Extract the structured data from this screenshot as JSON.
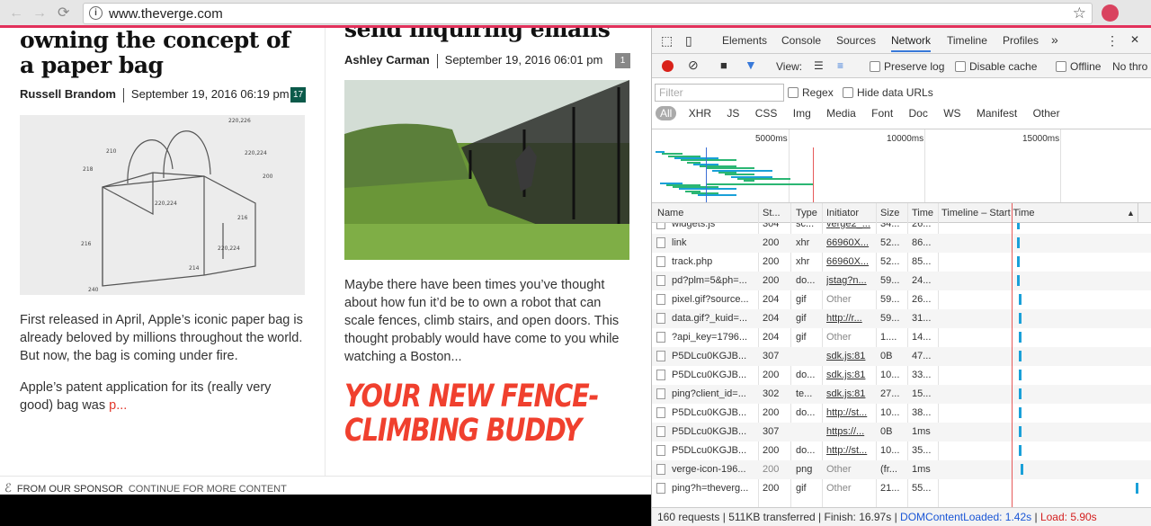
{
  "browser": {
    "url": "www.theverge.com",
    "info_icon": "i",
    "back_icon": "←",
    "forward_icon": "→",
    "reload_icon": "⟳",
    "star_icon": "☆"
  },
  "articles": [
    {
      "headline": "owning the concept of a paper bag",
      "author": "Russell Brandom",
      "date": "September 19, 2016 06:19 pm",
      "comments": "17",
      "excerpt_1": "First released in April, Apple’s iconic paper bag is already beloved by millions throughout the world. But now, the bag is coming under fire.",
      "excerpt_2": "Apple’s patent application for its (really very good) bag was ",
      "excerpt_2_link": "p..."
    },
    {
      "headline": "send inquiring emails",
      "author": "Ashley Carman",
      "date": "September 19, 2016 06:01 pm",
      "comments": "1",
      "excerpt_1": "Maybe there have been times you’ve thought about how fun it’d be to own a robot that can scale fences, climb stairs, and open doors. This thought probably would have come to you while watching a Boston...",
      "promo": "YOUR NEW FENCE-CLIMBING BUDDY"
    }
  ],
  "sponsor": {
    "label": "FROM OUR SPONSOR",
    "continue": "CONTINUE FOR MORE CONTENT"
  },
  "devtools": {
    "tabs": [
      "Elements",
      "Console",
      "Sources",
      "Network",
      "Timeline",
      "Profiles"
    ],
    "more": "»",
    "menu": "⋮",
    "close": "✕",
    "active_tab": "Network",
    "toolbar": {
      "view_label": "View:",
      "preserve_log": "Preserve log",
      "disable_cache": "Disable cache",
      "offline": "Offline",
      "throttle": "No thro"
    },
    "filter": {
      "placeholder": "Filter",
      "regex": "Regex",
      "hide_data_urls": "Hide data URLs",
      "types": [
        "All",
        "XHR",
        "JS",
        "CSS",
        "Img",
        "Media",
        "Font",
        "Doc",
        "WS",
        "Manifest",
        "Other"
      ]
    },
    "overview_ticks": [
      "5000ms",
      "10000ms",
      "15000ms"
    ],
    "columns": [
      "Name",
      "St...",
      "Type",
      "Initiator",
      "Size",
      "Time",
      "Timeline – Start Time"
    ],
    "sort_icon": "▲",
    "rows": [
      {
        "name": "widgets.js",
        "status": "304",
        "type": "sc...",
        "initiator": "verge2_...",
        "size": "34...",
        "time": "26...",
        "link": true,
        "start": 0.38
      },
      {
        "name": "link",
        "status": "200",
        "type": "xhr",
        "initiator": "66960X...",
        "size": "52...",
        "time": "86...",
        "link": true,
        "start": 0.38
      },
      {
        "name": "track.php",
        "status": "200",
        "type": "xhr",
        "initiator": "66960X...",
        "size": "52...",
        "time": "85...",
        "link": true,
        "start": 0.38
      },
      {
        "name": "pd?plm=5&ph=...",
        "status": "200",
        "type": "do...",
        "initiator": "jstag?n...",
        "size": "59...",
        "time": "24...",
        "link": true,
        "start": 0.38
      },
      {
        "name": "pixel.gif?source...",
        "status": "204",
        "type": "gif",
        "initiator": "Other",
        "size": "59...",
        "time": "26...",
        "link": false,
        "start": 0.39
      },
      {
        "name": "data.gif?_kuid=...",
        "status": "204",
        "type": "gif",
        "initiator": "http://r...",
        "size": "59...",
        "time": "31...",
        "link": true,
        "start": 0.39
      },
      {
        "name": "?api_key=1796...",
        "status": "204",
        "type": "gif",
        "initiator": "Other",
        "size": "1....",
        "time": "14...",
        "link": false,
        "start": 0.39
      },
      {
        "name": "P5DLcu0KGJB...",
        "status": "307",
        "type": "",
        "initiator": "sdk.js:81",
        "size": "0B",
        "time": "47...",
        "link": true,
        "start": 0.39
      },
      {
        "name": "P5DLcu0KGJB...",
        "status": "200",
        "type": "do...",
        "initiator": "sdk.js:81",
        "size": "10...",
        "time": "33...",
        "link": true,
        "start": 0.39
      },
      {
        "name": "ping?client_id=...",
        "status": "302",
        "type": "te...",
        "initiator": "sdk.js:81",
        "size": "27...",
        "time": "15...",
        "link": true,
        "start": 0.39
      },
      {
        "name": "P5DLcu0KGJB...",
        "status": "200",
        "type": "do...",
        "initiator": "http://st...",
        "size": "10...",
        "time": "38...",
        "link": true,
        "start": 0.39
      },
      {
        "name": "P5DLcu0KGJB...",
        "status": "307",
        "type": "",
        "initiator": "https://...",
        "size": "0B",
        "time": "1ms",
        "link": true,
        "start": 0.39
      },
      {
        "name": "P5DLcu0KGJB...",
        "status": "200",
        "type": "do...",
        "initiator": "http://st...",
        "size": "10...",
        "time": "35...",
        "link": true,
        "start": 0.39
      },
      {
        "name": "verge-icon-196...",
        "status": "200",
        "type": "png",
        "initiator": "Other",
        "size": "(fr...",
        "time": "1ms",
        "link": false,
        "start": 0.4,
        "grey_status": true
      },
      {
        "name": "ping?h=theverg...",
        "status": "200",
        "type": "gif",
        "initiator": "Other",
        "size": "21...",
        "time": "55...",
        "link": false,
        "start": 0.98
      }
    ],
    "status": {
      "requests": "160 requests",
      "transferred": "511KB transferred",
      "finish": "Finish: 16.97s",
      "dom": "DOMContentLoaded: 1.42s",
      "load": "Load: 5.90s",
      "sep": "|"
    }
  }
}
